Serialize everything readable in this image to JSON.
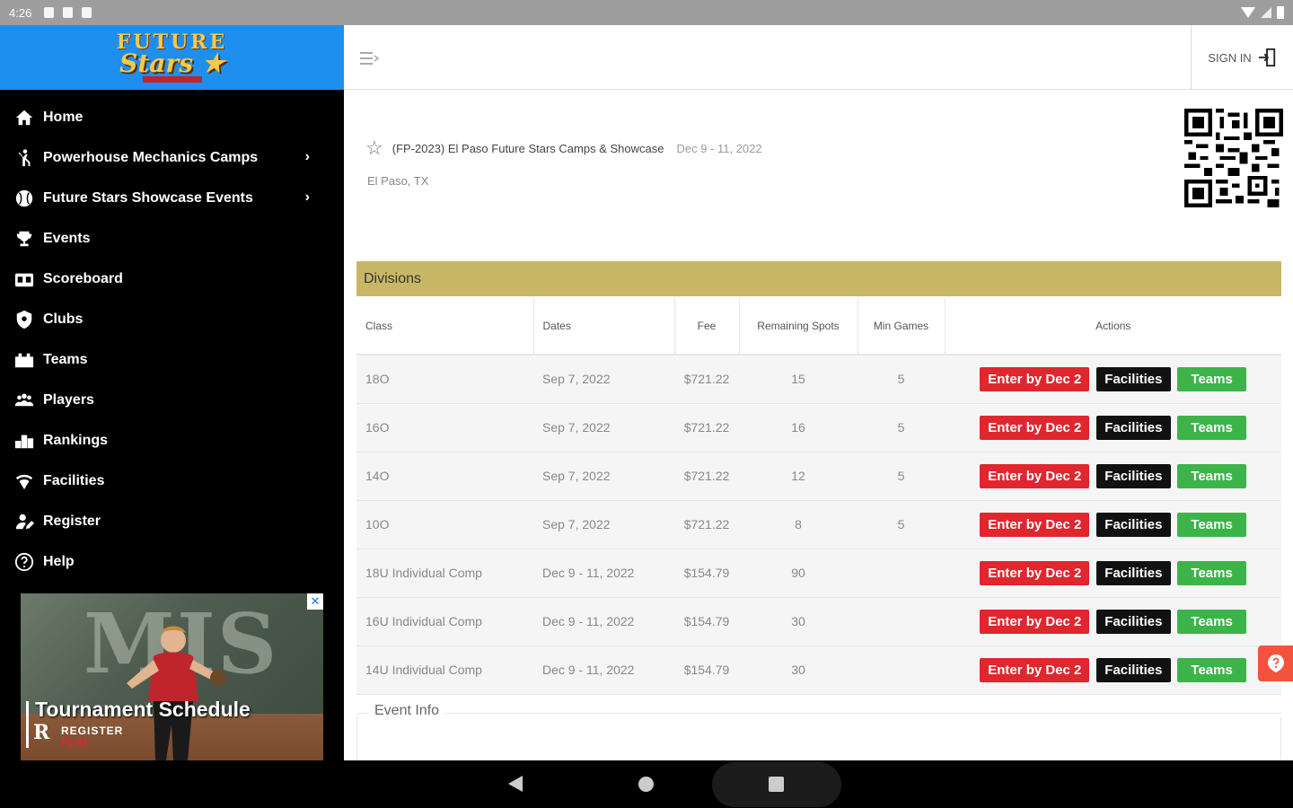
{
  "status_bar": {
    "time": "4:26"
  },
  "brand": {
    "top": "FUTURE",
    "main": "Stars ★"
  },
  "sidebar": {
    "items": [
      {
        "label": "Home",
        "icon": "home-icon",
        "has_children": false
      },
      {
        "label": "Powerhouse Mechanics Camps",
        "icon": "athlete-icon",
        "has_children": true
      },
      {
        "label": "Future Stars Showcase Events",
        "icon": "baseball-icon",
        "has_children": true
      },
      {
        "label": "Events",
        "icon": "trophy-icon",
        "has_children": false
      },
      {
        "label": "Scoreboard",
        "icon": "scoreboard-icon",
        "has_children": false
      },
      {
        "label": "Clubs",
        "icon": "shield-icon",
        "has_children": false
      },
      {
        "label": "Teams",
        "icon": "team-icon",
        "has_children": false
      },
      {
        "label": "Players",
        "icon": "players-icon",
        "has_children": false
      },
      {
        "label": "Rankings",
        "icon": "rankings-icon",
        "has_children": false
      },
      {
        "label": "Facilities",
        "icon": "location-icon",
        "has_children": false
      },
      {
        "label": "Register",
        "icon": "register-icon",
        "has_children": false
      },
      {
        "label": "Help",
        "icon": "help-icon",
        "has_children": false
      }
    ]
  },
  "ad": {
    "bg_letters": "MIS",
    "title": "Tournament Schedule",
    "rp": "R",
    "register": "REGISTER",
    "play": "PLAY",
    "close": "✕"
  },
  "topbar": {
    "signin_label": "SIGN IN"
  },
  "event": {
    "title": "(FP-2023) El Paso Future Stars Camps & Showcase",
    "dates": "Dec 9 - 11, 2022",
    "location": "El Paso, TX"
  },
  "divisions": {
    "header": "Divisions",
    "columns": [
      "Class",
      "Dates",
      "Fee",
      "Remaining Spots",
      "Min Games",
      "Actions"
    ],
    "rows": [
      {
        "class": "18O",
        "dates": "Sep 7, 2022",
        "fee": "$721.22",
        "remaining": "15",
        "min_games": "5"
      },
      {
        "class": "16O",
        "dates": "Sep 7, 2022",
        "fee": "$721.22",
        "remaining": "16",
        "min_games": "5"
      },
      {
        "class": "14O",
        "dates": "Sep 7, 2022",
        "fee": "$721.22",
        "remaining": "12",
        "min_games": "5"
      },
      {
        "class": "10O",
        "dates": "Sep 7, 2022",
        "fee": "$721.22",
        "remaining": "8",
        "min_games": "5"
      },
      {
        "class": "18U Individual Comp",
        "dates": "Dec 9 - 11, 2022",
        "fee": "$154.79",
        "remaining": "90",
        "min_games": ""
      },
      {
        "class": "16U Individual Comp",
        "dates": "Dec 9 - 11, 2022",
        "fee": "$154.79",
        "remaining": "30",
        "min_games": ""
      },
      {
        "class": "14U Individual Comp",
        "dates": "Dec 9 - 11, 2022",
        "fee": "$154.79",
        "remaining": "30",
        "min_games": ""
      }
    ],
    "actions": {
      "enter": "Enter by Dec 2",
      "facilities": "Facilities",
      "teams": "Teams"
    }
  },
  "event_info": {
    "legend": "Event Info"
  },
  "colors": {
    "brand_blue": "#1e8fee",
    "divisions_gold": "#c8b766",
    "enter_red": "#e0262e",
    "teams_green": "#3cb44a",
    "help_fab": "#f3533d"
  }
}
